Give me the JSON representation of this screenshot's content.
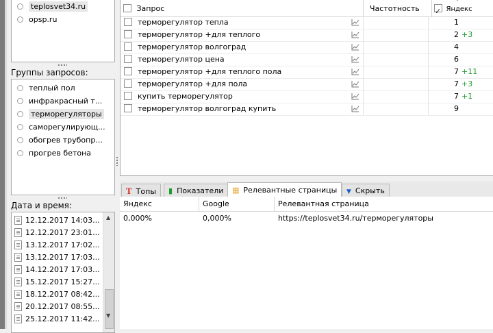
{
  "sites": [
    "teplosvet34.ru",
    "opsp.ru"
  ],
  "groups_label": "Группы запросов:",
  "groups": [
    "теплый пол",
    "инфракрасный т...",
    "терморегуляторы",
    "саморегулирующ...",
    "обогрев трубопр...",
    "прогрев бетона"
  ],
  "dates_label": "Дата и время:",
  "dates": [
    "12.12.2017 14:03...",
    "12.12.2017 23:01...",
    "13.12.2017 17:02...",
    "13.12.2017 17:03...",
    "14.12.2017 17:03...",
    "15.12.2017 15:27...",
    "18.12.2017 08:42...",
    "20.12.2017 08:55...",
    "25.12.2017 11:42..."
  ],
  "query_table": {
    "headers": {
      "query": "Запрос",
      "frequency": "Частотность",
      "yandex": "Яндекс"
    },
    "rows": [
      {
        "query": "терморегулятор тепла",
        "pos": "1",
        "delta": ""
      },
      {
        "query": "терморегулятор +для теплого",
        "pos": "2",
        "delta": "+3"
      },
      {
        "query": "терморегулятор волгоград",
        "pos": "4",
        "delta": ""
      },
      {
        "query": "терморегулятор цена",
        "pos": "6",
        "delta": ""
      },
      {
        "query": "терморегулятор +для теплого пола",
        "pos": "7",
        "delta": "+11"
      },
      {
        "query": "терморегулятор +для пола",
        "pos": "7",
        "delta": "+3"
      },
      {
        "query": "купить терморегулятор",
        "pos": "7",
        "delta": "+1"
      },
      {
        "query": "терморегулятор волгоград купить",
        "pos": "9",
        "delta": ""
      }
    ]
  },
  "tabs": {
    "tops": "Топы",
    "metrics": "Показатели",
    "relevant": "Релевантные страницы",
    "hide": "Скрыть"
  },
  "relevant_table": {
    "headers": {
      "yandex": "Яндекс",
      "google": "Google",
      "page": "Релевантная страница"
    },
    "rows": [
      {
        "yandex": "0,000%",
        "google": "0,000%",
        "page": "https://teplosvet34.ru/терморегуляторы"
      }
    ]
  },
  "colors": {
    "accent_red": "#d8261c",
    "accent_green": "#1f9a2e",
    "accent_blue": "#1a5fc8",
    "page_icon": "#e8a93a"
  }
}
